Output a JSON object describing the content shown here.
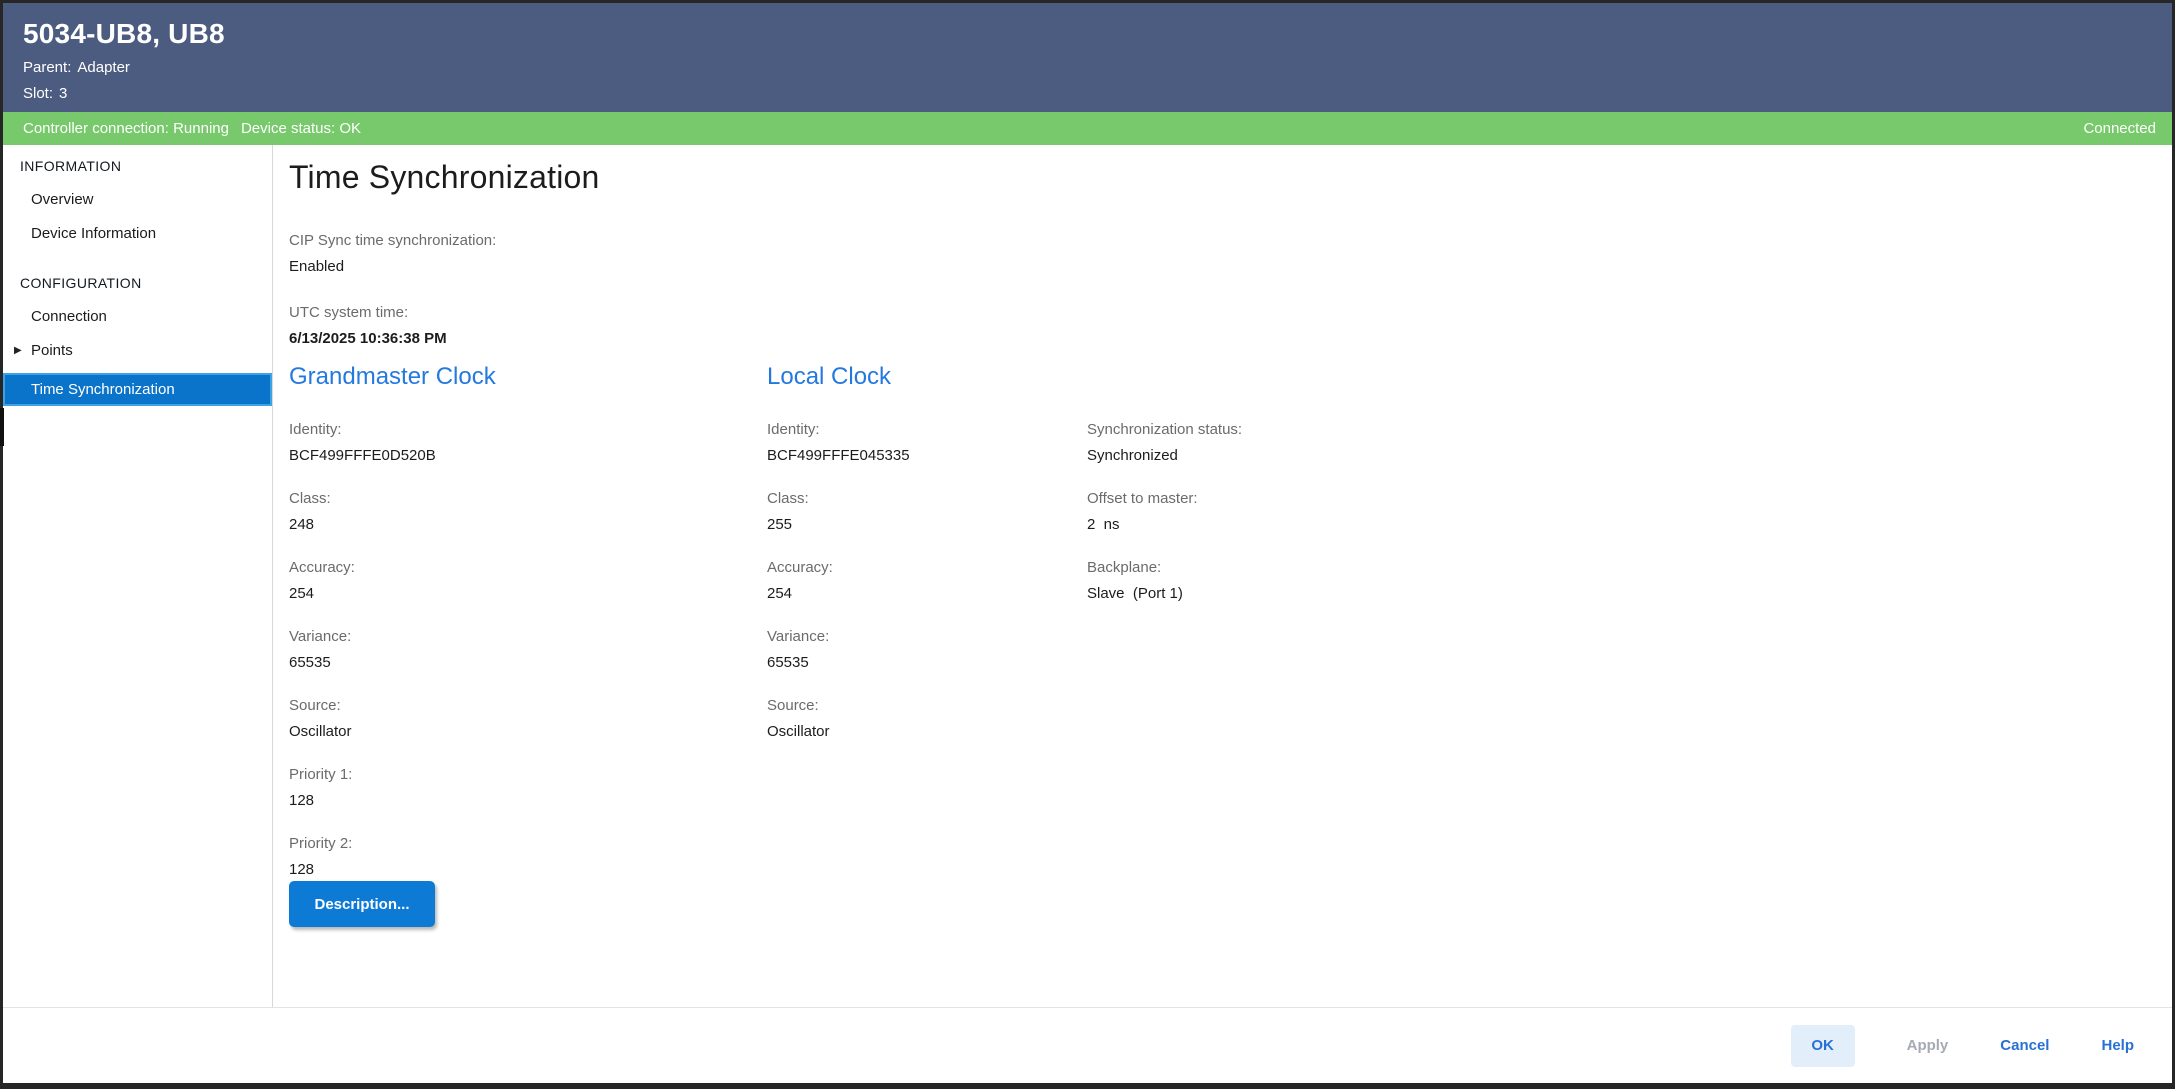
{
  "colors": {
    "header_bg": "#4c5c80",
    "status_bg": "#77c96b",
    "accent_blue": "#2479df",
    "selected_bg": "#0a73ca",
    "selected_border": "#3ea2e5",
    "primary_button_bg": "#0d7ad6",
    "footer_link": "#2970d6",
    "disabled_text": "#a5abb3",
    "label_text": "#6b6b6b",
    "value_text": "#1c1c1c"
  },
  "header": {
    "title": "5034-UB8, UB8",
    "parent_label": "Parent:",
    "parent_value": "Adapter",
    "slot_label": "Slot:",
    "slot_value": "3"
  },
  "status_bar": {
    "controller_connection": "Controller connection: Running",
    "device_status": "Device status: OK",
    "connection_state": "Connected"
  },
  "sidebar": {
    "sections": [
      {
        "label": "INFORMATION",
        "items": [
          {
            "label": "Overview"
          },
          {
            "label": "Device Information"
          }
        ]
      },
      {
        "label": "CONFIGURATION",
        "items": [
          {
            "label": "Connection"
          },
          {
            "label": "Points",
            "expander": "▶"
          },
          {
            "label": "Time Synchronization",
            "selected": true
          }
        ]
      }
    ]
  },
  "main": {
    "title": "Time Synchronization",
    "cip_sync": {
      "label": "CIP Sync time synchronization:",
      "value": "Enabled"
    },
    "utc_time": {
      "label": "UTC system time:",
      "value": "6/13/2025 10:36:38 PM"
    },
    "grandmaster": {
      "heading": "Grandmaster Clock",
      "identity": {
        "label": "Identity:",
        "value": "BCF499FFFE0D520B"
      },
      "clock_class": {
        "label": "Class:",
        "value": "248"
      },
      "accuracy": {
        "label": "Accuracy:",
        "value": "254"
      },
      "variance": {
        "label": "Variance:",
        "value": "65535"
      },
      "source": {
        "label": "Source:",
        "value": "Oscillator"
      },
      "priority1": {
        "label": "Priority 1:",
        "value": "128"
      },
      "priority2": {
        "label": "Priority 2:",
        "value": "128"
      },
      "description_button": "Description..."
    },
    "local": {
      "heading": "Local Clock",
      "identity": {
        "label": "Identity:",
        "value": "BCF499FFFE045335"
      },
      "clock_class": {
        "label": "Class:",
        "value": "255"
      },
      "accuracy": {
        "label": "Accuracy:",
        "value": "254"
      },
      "variance": {
        "label": "Variance:",
        "value": "65535"
      },
      "source": {
        "label": "Source:",
        "value": "Oscillator"
      }
    },
    "sync_status": {
      "status": {
        "label": "Synchronization status:",
        "value": "Synchronized"
      },
      "offset": {
        "label": "Offset to master:",
        "value": "2  ns"
      },
      "backplane": {
        "label": "Backplane:",
        "value": "Slave  (Port 1)"
      }
    }
  },
  "footer": {
    "ok": "OK",
    "apply": "Apply",
    "cancel": "Cancel",
    "help": "Help"
  }
}
